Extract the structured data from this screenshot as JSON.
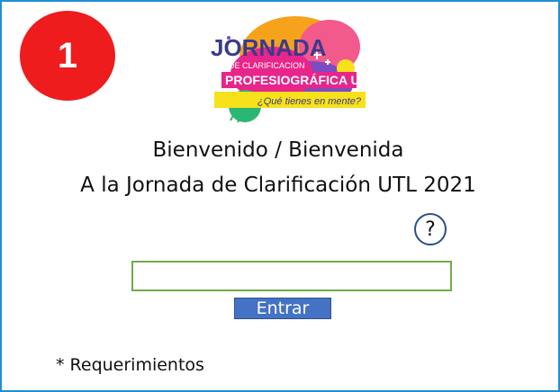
{
  "badge": {
    "number": "1"
  },
  "logo": {
    "line1": "JORNADA",
    "line2": "DE CLARIFICACION",
    "line3": "PROFESIOGRÁFICA UTL",
    "tagline": "¿Qué tienes en mente?"
  },
  "welcome": {
    "line1": "Bienvenido / Bienvenida",
    "line2": "A la Jornada de Clarificación UTL 2021"
  },
  "help": {
    "label": "?"
  },
  "form": {
    "input_value": "",
    "enter_label": "Entrar"
  },
  "requirements_label": "* Requerimientos",
  "colors": {
    "frame": "#1f8fd6",
    "badge": "#ee1c1c",
    "input_border": "#70ad47",
    "button": "#4472c4"
  }
}
